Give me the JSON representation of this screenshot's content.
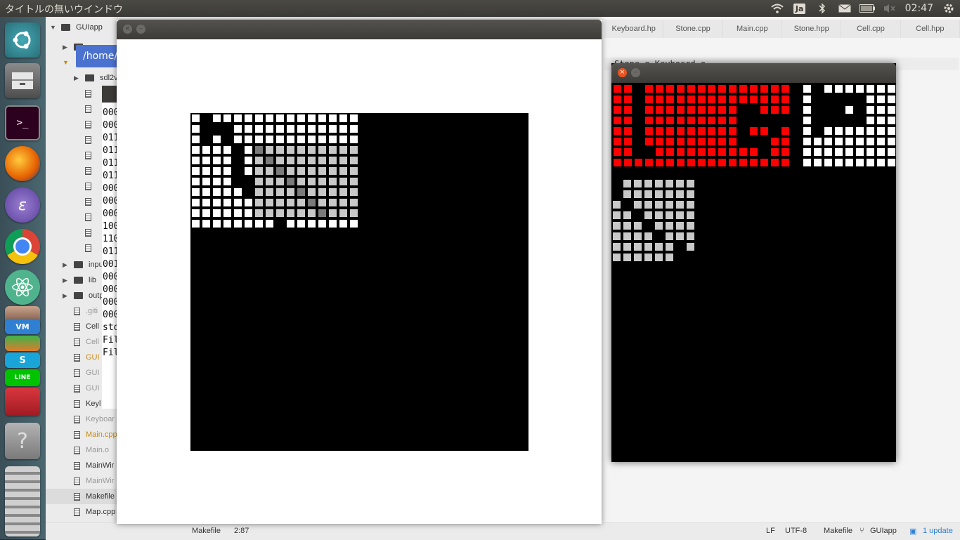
{
  "top_panel": {
    "title": "タイトルの無いウインドウ",
    "keyboard_layout": "Ja",
    "clock": "02:47",
    "tray_icons": [
      "wifi-icon",
      "keyboard-layout-icon",
      "bluetooth-icon",
      "mail-icon",
      "battery-icon",
      "volume-muted-icon",
      "settings-gear-icon"
    ]
  },
  "launcher": {
    "icons": [
      "ubuntu-dash-icon",
      "file-manager-icon",
      "terminal-icon",
      "firefox-icon",
      "emacs-icon",
      "chrome-icon",
      "atom-icon",
      "user-avatar-icon",
      "visual-studio-code-icon",
      "stacked-apps-icon",
      "line-icon",
      "software-center-icon",
      "help-icon",
      "workspace-switcher-icon"
    ]
  },
  "path_pill": "/home/r",
  "tree": {
    "root": "GUIapp",
    "items": [
      {
        "label": "sdl2v",
        "kind": "folder",
        "style": "normal"
      },
      {
        "label": "input",
        "kind": "folder",
        "style": "normal"
      },
      {
        "label": "lib",
        "kind": "folder",
        "style": "normal"
      },
      {
        "label": "outp",
        "kind": "folder",
        "style": "normal"
      },
      {
        "label": ".giti",
        "kind": "file",
        "style": "muted"
      },
      {
        "label": "Cell",
        "kind": "file",
        "style": "normal"
      },
      {
        "label": "Cell",
        "kind": "file",
        "style": "muted"
      },
      {
        "label": "GUI",
        "kind": "file",
        "style": "orange"
      },
      {
        "label": "GUI",
        "kind": "file",
        "style": "muted"
      },
      {
        "label": "GUI",
        "kind": "file",
        "style": "muted"
      },
      {
        "label": "Keyl",
        "kind": "file",
        "style": "normal"
      },
      {
        "label": "Keyboar",
        "kind": "file",
        "style": "muted"
      },
      {
        "label": "Main.cpp",
        "kind": "file",
        "style": "orange"
      },
      {
        "label": "Main.o",
        "kind": "file",
        "style": "muted"
      },
      {
        "label": "MainWir",
        "kind": "file",
        "style": "normal"
      },
      {
        "label": "MainWir",
        "kind": "file",
        "style": "muted"
      },
      {
        "label": "Makefile",
        "kind": "file",
        "style": "normal"
      },
      {
        "label": "Map.cpp",
        "kind": "file",
        "style": "normal"
      },
      {
        "label": "Map.o",
        "kind": "file",
        "style": "muted"
      }
    ]
  },
  "tabs": [
    "Keyboard.hp",
    "Stone.cpp",
    "Main.cpp",
    "Stone.hpp",
    "Cell.cpp",
    "Cell.hpp"
  ],
  "editor_line": "Stone.o Keyboard.o",
  "terminal_lines": [
    "000",
    "000",
    "011",
    "011",
    "011",
    "011",
    "000",
    "000",
    "000",
    "100",
    "110",
    "011",
    "001",
    "000",
    "000",
    "000",
    "000",
    "sto",
    "Fil",
    "Fil"
  ],
  "statusbar": {
    "file": "Makefile",
    "cursor": "2:87",
    "line_ending": "LF",
    "encoding": "UTF-8",
    "grammar": "Makefile",
    "branch": "GUIapp",
    "updates": "1 update"
  },
  "colors": {
    "board_red": "#ff0000",
    "board_white": "#ffffff",
    "board_light_gray": "#c8c8c8",
    "board_dark_gray": "#7a7a7a",
    "panel_bg": "#3c3b37",
    "accent_blue": "#4c72d0"
  },
  "board1": {
    "rows": [
      "W.WWWWWWWWWWWWWW",
      "W...WWWWWWWWWWWW",
      "W.W.WWWWWWWWWWWW",
      "WWWW.WGLLLLLLLLL",
      "WWWW.WLGLLLLLLLL",
      "WWWW.WLLGLLLLLLL",
      "WWWW..LLLGLLLLLL",
      "WWWWW.LLLLGLLLLL",
      "WWWWWWLLLLLGLLLL",
      "WWWWWWLLLLLLGLLL",
      "WWWWWWWW.WWWWWWW"
    ]
  },
  "board2": {
    "red_rows": [
      "RR.RRRRRR",
      "RR.RRRRRR",
      "RR.RRRRRR",
      "RR.RRRRRR",
      "RR.RRRRRR",
      "RR.RRRRRR",
      "RR..RRRRR",
      "RRRRRRRRR"
    ],
    "red2_rows": [
      "RRRRRRRR",
      "RRRRRRRR",
      "RRR..RRR",
      "RRR.....",
      "RRR.RR.R",
      "RRR...RR",
      "RRRRR.RR",
      "RRRRRRRR"
    ],
    "white_rows": [
      "W.WWWWWWW",
      "W.....WWW",
      "W...W.WWW",
      "W.....WWW",
      "W.WWWWWWW",
      "WWWWWWWWW",
      "WWWWWWWWW",
      "WWWWWWWWW"
    ],
    "gray_rows": [
      ".LLLLLLL",
      ".LLLLLLL",
      "L.LLLLLL",
      "LL.LLLLL",
      "LLL.LLLL",
      "LLLL.LLL",
      "LLLLLL.L",
      "LLLLLL.."
    ]
  }
}
